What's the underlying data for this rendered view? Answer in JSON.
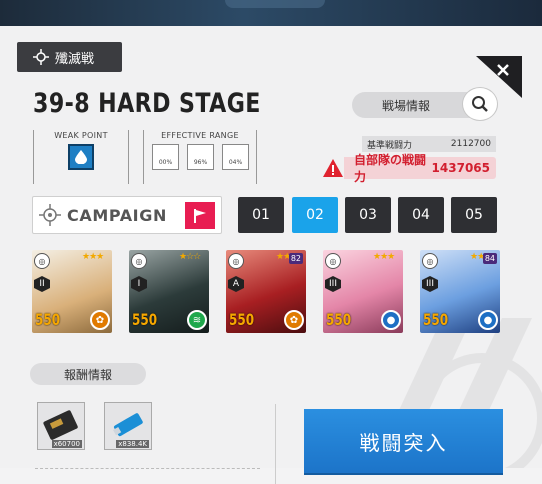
{
  "header": {
    "mode_label": "殲滅戦"
  },
  "stage": {
    "title": "39-8 HARD STAGE"
  },
  "battlefield": {
    "button_label": "戦場情報"
  },
  "weak_point": {
    "label": "WEAK  POINT",
    "element": "water"
  },
  "effective_range": {
    "label": "EFFECTIVE RANGE",
    "values": [
      "00%",
      "96%",
      "04%"
    ]
  },
  "power": {
    "base_label": "基準戦闘力",
    "base_value": "2112700",
    "my_label": "自部隊の戦闘力",
    "my_value": "1437065"
  },
  "campaign": {
    "label": "CAMPAIGN"
  },
  "squads": [
    "01",
    "02",
    "03",
    "04",
    "05"
  ],
  "active_squad": "02",
  "characters": [
    {
      "level": "550",
      "class": "II",
      "element": "fire",
      "color": "#d9b07a",
      "rank": ""
    },
    {
      "level": "550",
      "class": "I",
      "element": "wind",
      "color": "#2c3b3a",
      "rank": ""
    },
    {
      "level": "550",
      "class": "A",
      "element": "fire",
      "color": "#a81f22",
      "rank": "82"
    },
    {
      "level": "550",
      "class": "III",
      "element": "water",
      "color": "#e486a8",
      "rank": ""
    },
    {
      "level": "550",
      "class": "III",
      "element": "water",
      "color": "#6c9fe0",
      "rank": "84"
    }
  ],
  "rewards": {
    "label": "報酬情報",
    "items": [
      {
        "name": "credit-case",
        "qty": "x60700"
      },
      {
        "name": "battle-data",
        "qty": "x838.4K"
      }
    ]
  },
  "battle": {
    "label": "戦闘突入"
  }
}
